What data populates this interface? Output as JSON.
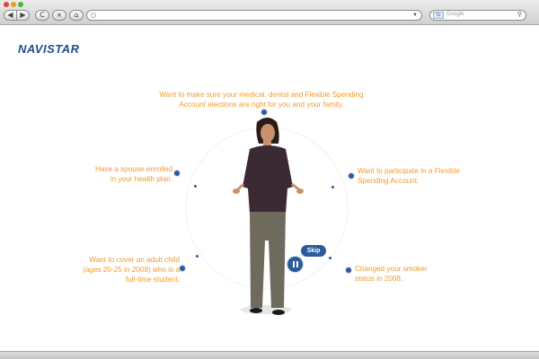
{
  "browser": {
    "back_label": "◀",
    "forward_label": "▶",
    "reload_label": "C",
    "stop_label": "×",
    "home_label": "⌂",
    "search_placeholder": "Google",
    "url_value": ""
  },
  "brand": {
    "logo_text": "NAVISTAR"
  },
  "prompts": {
    "top": "Want to make sure your medical, dental and Flexible Spending Account elections are right for you and your family.",
    "left_upper": "Have a spouse enrolled in your health plan.",
    "right_upper": "Want to participate in a Flexible Spending Account.",
    "left_lower": "Want to cover an adult child (ages 20-25 in 2009) who is a full-time student.",
    "right_lower": "Changed your smoker status in 2008."
  },
  "controls": {
    "skip_label": "Skip"
  },
  "colors": {
    "accent": "#f29a2e",
    "brand": "#1f4f8c",
    "control": "#2b5b9b"
  }
}
